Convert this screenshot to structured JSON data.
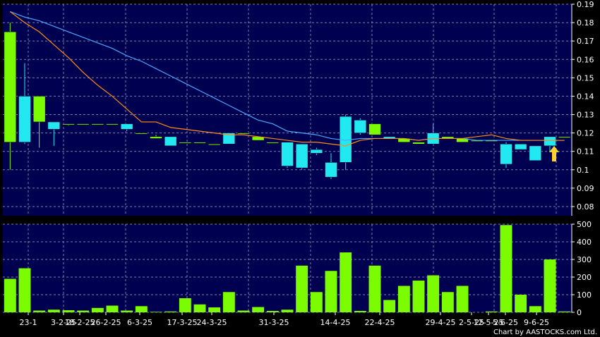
{
  "credit": "Chart by AASTOCKS.com Ltd.",
  "colors": {
    "background": "#000000",
    "plot_background": "#000050",
    "grid": "#7c7cb0",
    "up_candle": "#7cfc00",
    "down_candle": "#22e8f2",
    "volume_bar": "#7cfc00",
    "ma_short": "#ff8c1a",
    "ma_long": "#4aa8ff",
    "arrow": "#ffd22e"
  },
  "chart_data": [
    {
      "type": "candlestick",
      "grid": true,
      "ylim": [
        0.075,
        0.19
      ],
      "yticks": [
        "0.08",
        "0.09",
        "0.1",
        "0.11",
        "0.12",
        "0.13",
        "0.14",
        "0.15",
        "0.16",
        "0.17",
        "0.18",
        "0.19"
      ],
      "candles": [
        {
          "open": 0.115,
          "high": 0.18,
          "low": 0.1,
          "close": 0.175
        },
        {
          "open": 0.14,
          "high": 0.158,
          "low": 0.114,
          "close": 0.115
        },
        {
          "open": 0.126,
          "high": 0.14,
          "low": 0.112,
          "close": 0.14
        },
        {
          "open": 0.126,
          "high": 0.126,
          "low": 0.113,
          "close": 0.122
        },
        {
          "open": 0.125,
          "high": 0.125,
          "low": 0.124,
          "close": 0.125
        },
        {
          "open": 0.125,
          "high": 0.125,
          "low": 0.125,
          "close": 0.125
        },
        {
          "open": 0.125,
          "high": 0.125,
          "low": 0.125,
          "close": 0.125
        },
        {
          "open": 0.125,
          "high": 0.125,
          "low": 0.125,
          "close": 0.125
        },
        {
          "open": 0.125,
          "high": 0.125,
          "low": 0.121,
          "close": 0.122
        },
        {
          "open": 0.12,
          "high": 0.12,
          "low": 0.12,
          "close": 0.12
        },
        {
          "open": 0.117,
          "high": 0.119,
          "low": 0.117,
          "close": 0.118
        },
        {
          "open": 0.118,
          "high": 0.118,
          "low": 0.113,
          "close": 0.113
        },
        {
          "open": 0.115,
          "high": 0.115,
          "low": 0.115,
          "close": 0.115
        },
        {
          "open": 0.115,
          "high": 0.115,
          "low": 0.115,
          "close": 0.115
        },
        {
          "open": 0.114,
          "high": 0.114,
          "low": 0.114,
          "close": 0.114
        },
        {
          "open": 0.12,
          "high": 0.12,
          "low": 0.114,
          "close": 0.114
        },
        {
          "open": 0.12,
          "high": 0.12,
          "low": 0.12,
          "close": 0.12
        },
        {
          "open": 0.116,
          "high": 0.118,
          "low": 0.116,
          "close": 0.118
        },
        {
          "open": 0.115,
          "high": 0.115,
          "low": 0.115,
          "close": 0.115
        },
        {
          "open": 0.115,
          "high": 0.115,
          "low": 0.101,
          "close": 0.102
        },
        {
          "open": 0.114,
          "high": 0.114,
          "low": 0.1,
          "close": 0.101
        },
        {
          "open": 0.111,
          "high": 0.112,
          "low": 0.108,
          "close": 0.109
        },
        {
          "open": 0.104,
          "high": 0.109,
          "low": 0.095,
          "close": 0.096
        },
        {
          "open": 0.129,
          "high": 0.13,
          "low": 0.1,
          "close": 0.104
        },
        {
          "open": 0.127,
          "high": 0.128,
          "low": 0.119,
          "close": 0.12
        },
        {
          "open": 0.119,
          "high": 0.125,
          "low": 0.119,
          "close": 0.125
        },
        {
          "open": 0.118,
          "high": 0.118,
          "low": 0.117,
          "close": 0.117
        },
        {
          "open": 0.115,
          "high": 0.117,
          "low": 0.115,
          "close": 0.117
        },
        {
          "open": 0.114,
          "high": 0.115,
          "low": 0.114,
          "close": 0.115
        },
        {
          "open": 0.12,
          "high": 0.125,
          "low": 0.114,
          "close": 0.114
        },
        {
          "open": 0.117,
          "high": 0.118,
          "low": 0.117,
          "close": 0.118
        },
        {
          "open": 0.115,
          "high": 0.117,
          "low": 0.115,
          "close": 0.117
        },
        {
          "open": 0.116,
          "high": 0.116,
          "low": 0.116,
          "close": 0.116
        },
        {
          "open": 0.116,
          "high": 0.116,
          "low": 0.116,
          "close": 0.116
        },
        {
          "open": 0.114,
          "high": 0.115,
          "low": 0.101,
          "close": 0.103
        },
        {
          "open": 0.114,
          "high": 0.114,
          "low": 0.111,
          "close": 0.111
        },
        {
          "open": 0.113,
          "high": 0.113,
          "low": 0.105,
          "close": 0.105
        },
        {
          "open": 0.118,
          "high": 0.118,
          "low": 0.11,
          "close": 0.113
        },
        {
          "open": 0.118,
          "high": 0.118,
          "low": 0.118,
          "close": 0.118
        }
      ],
      "ma_short": [
        0.186,
        0.18,
        0.175,
        0.168,
        0.161,
        0.153,
        0.146,
        0.14,
        0.133,
        0.126,
        0.126,
        0.123,
        0.122,
        0.121,
        0.12,
        0.119,
        0.119,
        0.118,
        0.117,
        0.116,
        0.115,
        0.115,
        0.114,
        0.113,
        0.116,
        0.117,
        0.117,
        0.117,
        0.116,
        0.117,
        0.117,
        0.117,
        0.118,
        0.119,
        0.117,
        0.116,
        0.116,
        0.116,
        0.116
      ],
      "ma_long": [
        0.186,
        0.183,
        0.181,
        0.178,
        0.175,
        0.172,
        0.169,
        0.166,
        0.162,
        0.159,
        0.155,
        0.151,
        0.147,
        0.143,
        0.139,
        0.135,
        0.131,
        0.127,
        0.125,
        0.121,
        0.12,
        0.119,
        0.117,
        0.116,
        0.117,
        0.117,
        0.117,
        0.117,
        0.116,
        0.117,
        0.117,
        0.117,
        0.116,
        0.116,
        0.116,
        0.116,
        0.116,
        0.116,
        0.116
      ],
      "annotation": "arrow"
    },
    {
      "type": "bar",
      "grid": true,
      "ylim": [
        0,
        500
      ],
      "yticks": [
        "0",
        "100",
        "200",
        "300",
        "400",
        "500"
      ],
      "values": [
        190,
        250,
        10,
        15,
        12,
        10,
        25,
        38,
        10,
        35,
        3,
        5,
        80,
        45,
        28,
        115,
        10,
        30,
        8,
        15,
        265,
        115,
        235,
        340,
        8,
        265,
        70,
        150,
        180,
        210,
        115,
        150,
        0,
        5,
        495,
        100,
        35,
        300,
        5
      ],
      "xtick_labels": [
        "23-1",
        "3-2-25",
        "18-2-25",
        "26-2-25",
        "6-3-25",
        "17-3-25",
        "24-3-25",
        "31-3-25",
        "14-4-25",
        "22-4-25",
        "29-4-25",
        "2-5-25",
        "12-5-25",
        "5-6-25",
        "9-6-25"
      ]
    }
  ]
}
